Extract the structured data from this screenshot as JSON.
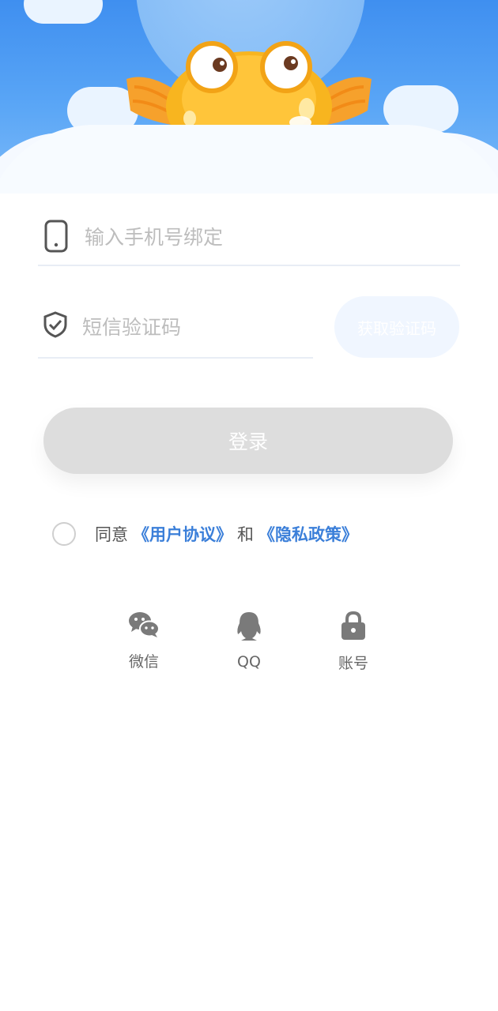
{
  "login": {
    "phone_placeholder": "输入手机号绑定",
    "sms_placeholder": "短信验证码",
    "get_code_label": "获取验证码",
    "submit_label": "登录"
  },
  "agreement": {
    "prefix": "同意",
    "user_agreement": "《用户协议》",
    "and": "和",
    "privacy_policy": "《隐私政策》"
  },
  "social": [
    {
      "label": "微信",
      "icon": "wechat-icon"
    },
    {
      "label": "QQ",
      "icon": "qq-icon"
    },
    {
      "label": "账号",
      "icon": "lock-icon"
    }
  ],
  "colors": {
    "sky": "#4a98f2",
    "link": "#3b7fd9",
    "button_disabled": "#dddddd",
    "code_button": "#f0f6ff"
  }
}
